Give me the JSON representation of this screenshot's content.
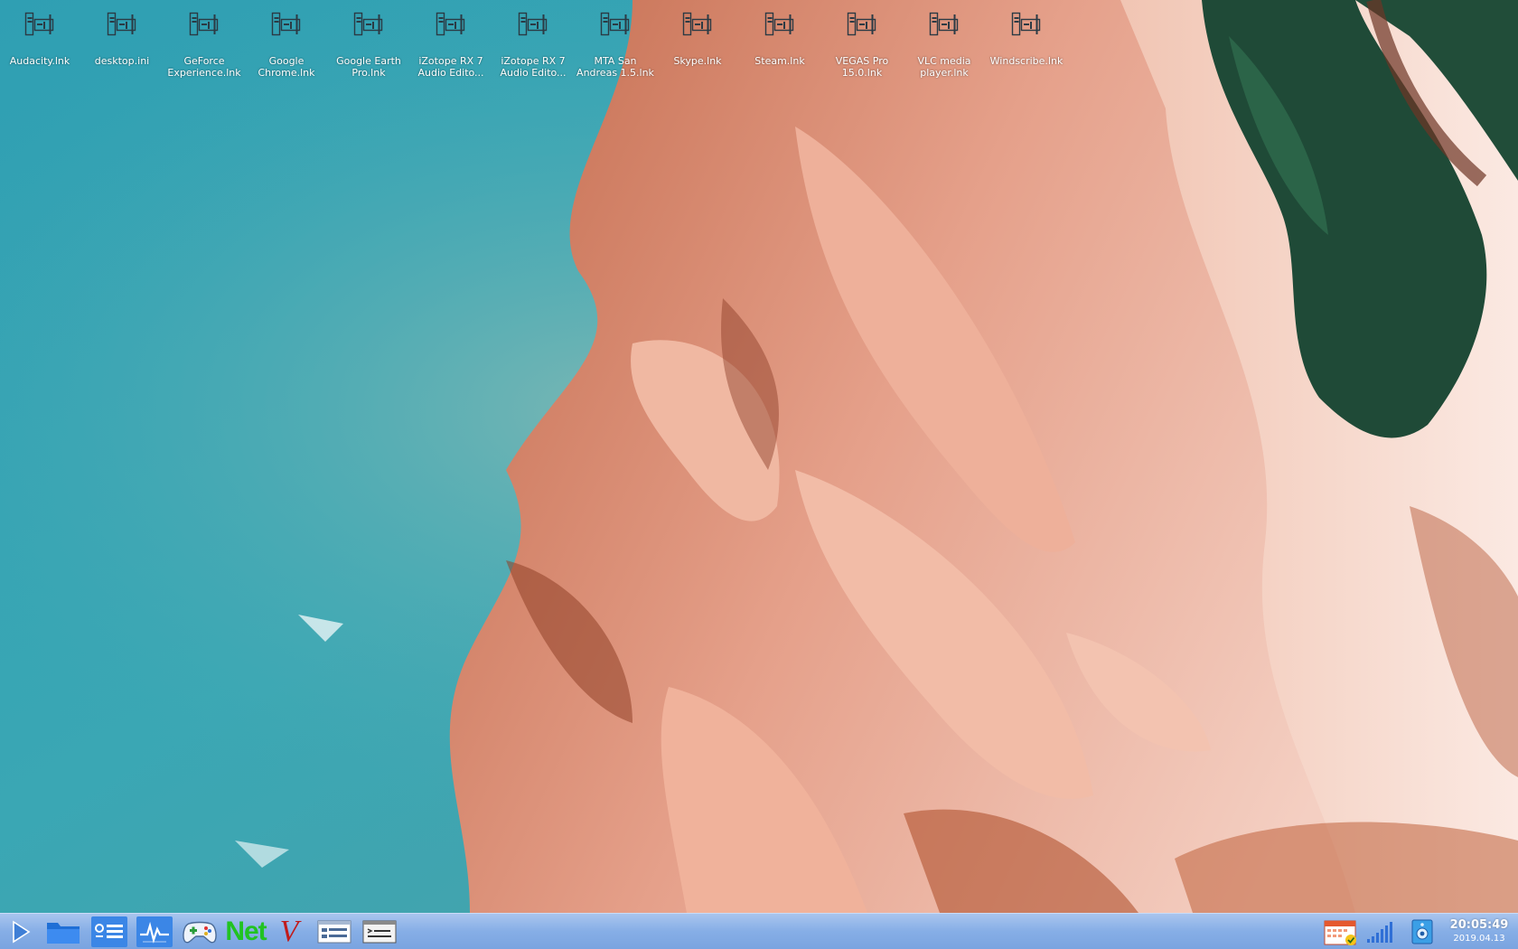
{
  "desktop": {
    "icons": [
      {
        "label": "Audacity.lnk",
        "icon": "shortcut-file-icon"
      },
      {
        "label": "desktop.ini",
        "icon": "shortcut-file-icon"
      },
      {
        "label": "GeForce Experience.lnk",
        "icon": "shortcut-file-icon"
      },
      {
        "label": "Google Chrome.lnk",
        "icon": "shortcut-file-icon"
      },
      {
        "label": "Google Earth Pro.lnk",
        "icon": "shortcut-file-icon"
      },
      {
        "label": "iZotope RX 7 Audio Edito...",
        "icon": "shortcut-file-icon"
      },
      {
        "label": "iZotope RX 7 Audio Edito...",
        "icon": "shortcut-file-icon"
      },
      {
        "label": "MTA San Andreas 1.5.lnk",
        "icon": "shortcut-file-icon"
      },
      {
        "label": "Skype.lnk",
        "icon": "shortcut-file-icon"
      },
      {
        "label": "Steam.lnk",
        "icon": "shortcut-file-icon"
      },
      {
        "label": "VEGAS Pro 15.0.lnk",
        "icon": "shortcut-file-icon"
      },
      {
        "label": "VLC media player.lnk",
        "icon": "shortcut-file-icon"
      },
      {
        "label": "Windscribe.lnk",
        "icon": "shortcut-file-icon"
      }
    ],
    "wallpaper": "aerial-beach-sandbar"
  },
  "taskbar": {
    "buttons": [
      {
        "name": "start-menu-button",
        "icon": "play-triangle-icon"
      },
      {
        "name": "file-manager-button",
        "icon": "folder-icon"
      },
      {
        "name": "task-list-button",
        "icon": "task-list-icon"
      },
      {
        "name": "system-monitor-button",
        "icon": "pulse-icon"
      },
      {
        "name": "games-button",
        "icon": "gamepad-icon"
      },
      {
        "name": "network-button",
        "icon": "net-text-icon",
        "text": "Net"
      },
      {
        "name": "editor-button",
        "icon": "v-letter-icon",
        "text": "V"
      },
      {
        "name": "window-list-button",
        "icon": "window-list-icon"
      },
      {
        "name": "terminal-button",
        "icon": "terminal-icon"
      }
    ],
    "tray": [
      {
        "name": "calendar-tray",
        "icon": "calendar-check-icon"
      },
      {
        "name": "network-signal-tray",
        "icon": "signal-bars-icon"
      },
      {
        "name": "audio-tray",
        "icon": "speaker-device-icon"
      }
    ],
    "clock": {
      "time": "20:05:49",
      "date": "2019.04.13"
    }
  },
  "colors": {
    "taskbar": "#86aee6",
    "active_button": "#3b86e6",
    "net_text": "#21c321",
    "v_text": "#c11b1b",
    "sea": "#3a9db0",
    "sand": "#e8a489"
  }
}
